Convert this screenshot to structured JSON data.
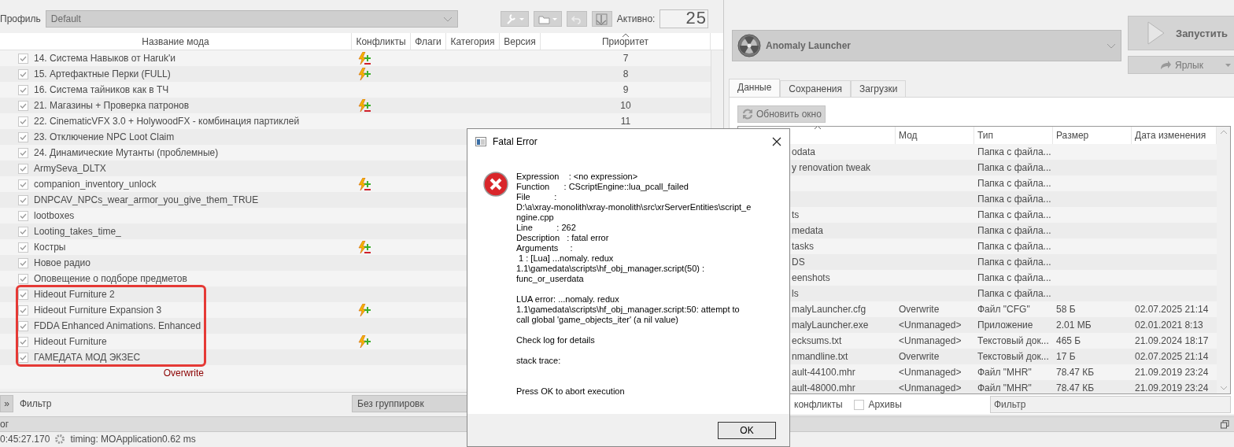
{
  "profile_bar": {
    "label": "Профиль",
    "profile": "Default",
    "active_label": "Активно:",
    "active_count": "25"
  },
  "mod_list": {
    "columns": [
      {
        "label": "Название мода",
        "sorted": false
      },
      {
        "label": "Конфликты",
        "sorted": false
      },
      {
        "label": "Флаги",
        "sorted": false
      },
      {
        "label": "Категория",
        "sorted": false
      },
      {
        "label": "Версия",
        "sorted": false
      },
      {
        "label": "Приоритет",
        "sorted": true
      }
    ],
    "rows": [
      {
        "kind": "mod",
        "name": "14. Система Навыков от Haruk'и",
        "checked": true,
        "overwrites": true,
        "overwritten": true,
        "priority": "7",
        "highlighted": false
      },
      {
        "kind": "mod",
        "name": "15. Артефактные Перки (FULL)",
        "checked": true,
        "overwrites": true,
        "overwritten": false,
        "priority": "8",
        "highlighted": false
      },
      {
        "kind": "mod",
        "name": "16. Система тайников как в ТЧ",
        "checked": true,
        "overwrites": false,
        "overwritten": false,
        "priority": "9",
        "highlighted": false
      },
      {
        "kind": "mod",
        "name": "21. Магазины + Проверка патронов",
        "checked": true,
        "overwrites": true,
        "overwritten": true,
        "priority": "10",
        "highlighted": false
      },
      {
        "kind": "mod",
        "name": "22. CinematicVFX 3.0 + HolywoodFX - комбинация партиклей",
        "checked": true,
        "overwrites": false,
        "overwritten": false,
        "priority": "11",
        "highlighted": false
      },
      {
        "kind": "mod",
        "name": "23. Отключение NPC Loot Claim",
        "checked": true,
        "overwrites": false,
        "overwritten": false,
        "highlighted": false
      },
      {
        "kind": "mod",
        "name": "24. Динамические Мутанты (проблемные)",
        "checked": true,
        "overwrites": false,
        "overwritten": false,
        "highlighted": false
      },
      {
        "kind": "mod",
        "name": "ArmySeva_DLTX",
        "checked": true,
        "overwrites": false,
        "overwritten": false,
        "highlighted": false
      },
      {
        "kind": "mod",
        "name": "companion_inventory_unlock",
        "checked": true,
        "overwrites": true,
        "overwritten": true,
        "highlighted": false
      },
      {
        "kind": "mod",
        "name": "DNPCAV_NPCs_wear_armor_you_give_them_TRUE",
        "checked": true,
        "overwrites": false,
        "overwritten": false,
        "highlighted": false
      },
      {
        "kind": "mod",
        "name": "lootboxes",
        "checked": true,
        "overwrites": false,
        "overwritten": false,
        "highlighted": false
      },
      {
        "kind": "mod",
        "name": "Looting_takes_time_",
        "checked": true,
        "overwrites": false,
        "overwritten": false,
        "highlighted": false
      },
      {
        "kind": "mod",
        "name": "Костры",
        "checked": true,
        "overwrites": true,
        "overwritten": true,
        "highlighted": false
      },
      {
        "kind": "mod",
        "name": "Новое радио",
        "checked": true,
        "overwrites": false,
        "overwritten": false,
        "highlighted": false
      },
      {
        "kind": "mod",
        "name": "Оповещение о подборе предметов",
        "checked": true,
        "overwrites": false,
        "overwritten": false,
        "highlighted": false
      },
      {
        "kind": "mod",
        "name": "Hideout Furniture 2",
        "checked": true,
        "overwrites": false,
        "overwritten": false,
        "highlighted": true
      },
      {
        "kind": "mod",
        "name": "Hideout Furniture Expansion 3",
        "checked": true,
        "overwrites": true,
        "overwritten": false,
        "highlighted": true
      },
      {
        "kind": "mod",
        "name": "FDDA Enhanced Animations. Enhanced",
        "checked": true,
        "overwrites": false,
        "overwritten": false,
        "highlighted": true
      },
      {
        "kind": "mod",
        "name": "Hideout Furniture",
        "checked": true,
        "overwrites": true,
        "overwritten": false,
        "highlighted": true
      },
      {
        "kind": "mod",
        "name": "ГАМЕДАТА МОД ЭКЗЕС",
        "checked": true,
        "overwrites": false,
        "overwritten": false,
        "highlighted": true
      },
      {
        "kind": "overwrite",
        "name": "Overwrite"
      }
    ]
  },
  "filter_bar": {
    "collapse_button": "»",
    "filter_label": "Фильтр",
    "grouping": "Без группировк"
  },
  "launcher": {
    "executable": "Anomaly Launcher",
    "run_button": "Запустить",
    "shortcut_button": "Ярлык"
  },
  "tabs": [
    {
      "label": "Данные",
      "selected": true
    },
    {
      "label": "Сохранения",
      "selected": false
    },
    {
      "label": "Загрузки",
      "selected": false
    }
  ],
  "refresh_button": "Обновить окно",
  "data_table": {
    "columns": [
      "Мод",
      "Тип",
      "Размер",
      "Дата изменения"
    ],
    "rows": [
      {
        "name": "odata",
        "type": "Папка с файла..."
      },
      {
        "name": "y renovation tweak",
        "type": "Папка с файла..."
      },
      {
        "type": "Папка с файла..."
      },
      {
        "type": "Папка с файла..."
      },
      {
        "name": "ts",
        "type": "Папка с файла..."
      },
      {
        "name": "medata",
        "type": "Папка с файла..."
      },
      {
        "name": "tasks",
        "type": "Папка с файла..."
      },
      {
        "name": "DS",
        "type": "Папка с файла..."
      },
      {
        "name": "eenshots",
        "type": "Папка с файла..."
      },
      {
        "name": "ls",
        "type": "Папка с файла..."
      },
      {
        "name": "malyLauncher.cfg",
        "mod": "Overwrite",
        "type": "Файл \"CFG\"",
        "size": "58 Б",
        "date": "02.07.2025 21:14"
      },
      {
        "name": "malyLauncher.exe",
        "mod": "<Unmanaged>",
        "type": "Приложение",
        "size": "2.01 МБ",
        "date": "02.01.2021 8:13"
      },
      {
        "name": "ecksums.txt",
        "mod": "<Unmanaged>",
        "type": "Текстовый док...",
        "size": "465 Б",
        "date": "21.09.2024 18:17"
      },
      {
        "name": "nmandline.txt",
        "mod": "Overwrite",
        "type": "Текстовый док...",
        "size": "17 Б",
        "date": "02.07.2025 21:14"
      },
      {
        "name": "ault-44100.mhr",
        "mod": "<Unmanaged>",
        "type": "Файл \"MHR\"",
        "size": "78.47 КБ",
        "date": "21.09.2019 23:24"
      },
      {
        "name": "ault-48000.mhr",
        "mod": "<Unmanaged>",
        "type": "Файл \"MHR\"",
        "size": "78.47 КБ",
        "date": "21.09.2019 23:24"
      }
    ]
  },
  "data_options": [
    {
      "label": "конфликты"
    },
    {
      "label": "Архивы",
      "checked": false
    }
  ],
  "data_filter": {
    "placeholder": "Фильтр"
  },
  "log": {
    "title": "ог",
    "entries": [
      {
        "time": "0:45:27.170",
        "message": "timing: MOApplication0.62 ms"
      }
    ]
  },
  "dialog": {
    "title": "Fatal Error",
    "paragraphs": [
      [
        "Expression    : <no expression>",
        "Function      : CScriptEngine::lua_pcall_failed",
        "File          :",
        "D:\\a\\xray-monolith\\xray-monolith\\src\\xrServerEntities\\script_e",
        "ngine.cpp",
        "Line          : 262",
        "Description   : fatal error",
        "Arguments     :",
        " 1 : [Lua] ...nomaly. redux",
        "1.1\\gamedata\\scripts\\hf_obj_manager.script(50) :",
        "func_or_userdata"
      ],
      [
        "LUA error: ...nomaly. redux",
        "1.1\\gamedata\\scripts\\hf_obj_manager.script:50: attempt to",
        "call global 'game_objects_iter' (a nil value)"
      ],
      [
        "Check log for details"
      ],
      [
        "stack trace:"
      ],
      [
        "Press OK to abort execution"
      ]
    ],
    "ok_button": "OK"
  }
}
